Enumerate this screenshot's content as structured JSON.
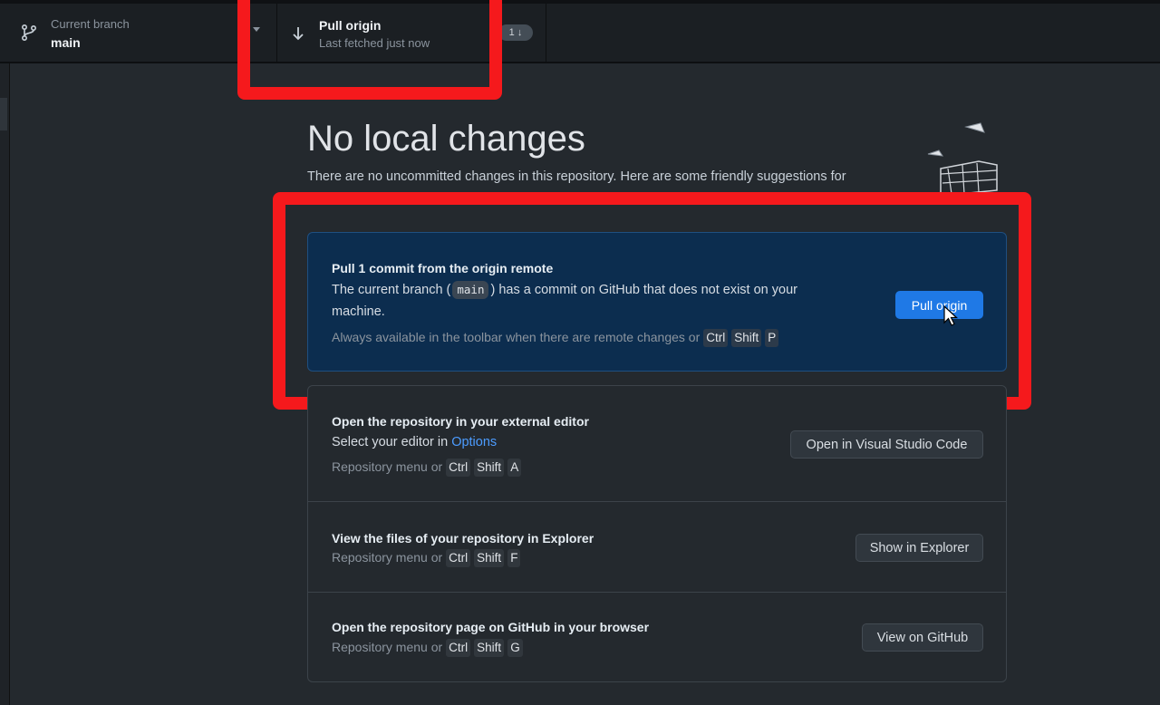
{
  "toolbar": {
    "branch": {
      "label": "Current branch",
      "value": "main"
    },
    "pull": {
      "title": "Pull origin",
      "subtitle": "Last fetched just now",
      "badge": "1 ↓"
    }
  },
  "main": {
    "heading": "No local changes",
    "subtext": "There are no uncommitted changes in this repository. Here are some friendly suggestions for",
    "pull_panel": {
      "title": "Pull 1 commit from the origin remote",
      "text_before": "The current branch (",
      "branch": "main",
      "text_after": ") has a commit on GitHub that does not exist on your machine.",
      "hint": "Always available in the toolbar when there are remote changes or",
      "keys": [
        "Ctrl",
        "Shift",
        "P"
      ],
      "button": "Pull origin"
    },
    "actions": [
      {
        "title": "Open the repository in your external editor",
        "desc_prefix": "Select your editor in",
        "desc_link": "Options",
        "hint": "Repository menu or",
        "keys": [
          "Ctrl",
          "Shift",
          "A"
        ],
        "button": "Open in Visual Studio Code"
      },
      {
        "title": "View the files of your repository in Explorer",
        "hint": "Repository menu or",
        "keys": [
          "Ctrl",
          "Shift",
          "F"
        ],
        "button": "Show in Explorer"
      },
      {
        "title": "Open the repository page on GitHub in your browser",
        "hint": "Repository menu or",
        "keys": [
          "Ctrl",
          "Shift",
          "G"
        ],
        "button": "View on GitHub"
      }
    ]
  },
  "colors": {
    "highlight": "#f5191c",
    "primary": "#1f79e6",
    "panel": "#0c2d4f",
    "link": "#4c9cff"
  },
  "icons": [
    "branch-icon",
    "arrow-down-icon",
    "illustration-icon",
    "cursor-icon"
  ]
}
